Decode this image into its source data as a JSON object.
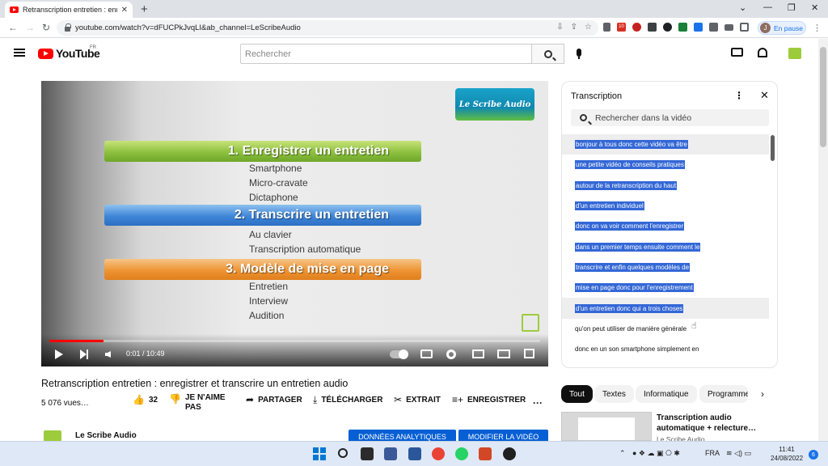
{
  "browser": {
    "tab_title": "Retranscription entretien : enregi",
    "url": "youtube.com/watch?v=dFUCPkJvqLI&ab_channel=LeScribeAudio",
    "profile_initial": "J",
    "profile_status": "En pause",
    "new_tab_symbol": "+",
    "close_symbol": "✕",
    "ext_badge": "10"
  },
  "header": {
    "logo_text": "YouTube",
    "country_code": "FR",
    "search_placeholder": "Rechercher"
  },
  "video": {
    "channel_logo_text": "Le Scribe Audio",
    "slide": {
      "heading1": "1. Enregistrer un entretien",
      "items1": [
        "Smartphone",
        "Micro-cravate",
        "Dictaphone"
      ],
      "heading2": "2. Transcrire un entretien",
      "items2": [
        "Au clavier",
        "Transcription automatique"
      ],
      "heading3": "3. Modèle de mise en page",
      "items3": [
        "Entretien",
        "Interview",
        "Audition"
      ]
    },
    "time_display": "0:01 / 10:49",
    "progress_fraction": 0.11,
    "title": "Retranscription entretien : enregistrer et transcrire un entretien audio",
    "views": "5 076 vues…",
    "likes": "32",
    "dislike_label": "JE N'AIME PAS",
    "share_label": "PARTAGER",
    "download_label": "TÉLÉCHARGER",
    "clip_label": "EXTRAIT",
    "save_label": "ENREGISTRER",
    "channel_name": "Le Scribe Audio",
    "analytics_label": "DONNÉES ANALYTIQUES",
    "edit_label": "MODIFIER LA VIDÉO"
  },
  "transcript": {
    "title": "Transcription",
    "search_placeholder": "Rechercher dans la vidéo",
    "lines": [
      "bonjour à tous donc cette vidéo va être",
      "une petite vidéo de conseils pratiques",
      "autour de la retranscription du haut",
      "d'un entretien individuel",
      "donc on va voir comment l'enregistrer",
      "dans un premier temps ensuite comment le",
      "transcrire et enfin quelques modèles de",
      "mise en page donc pour l'enregistrement",
      "d'un entretien donc qui a trois choses",
      "qu'on peut utiliser de manière générale",
      "donc en un son smartphone simplement en"
    ]
  },
  "chips": [
    "Tout",
    "Textes",
    "Informatique",
    "Programme"
  ],
  "recommendation": {
    "title": "Transcription audio automatique + relecture…",
    "channel": "Le Scribe Audio"
  },
  "taskbar": {
    "lang": "FRA",
    "time": "11:41",
    "date": "24/08/2022",
    "notifications": "6"
  },
  "colors": {
    "youtube_red": "#ff0000",
    "highlight_blue": "#3367d6",
    "button_blue": "#065fd4"
  }
}
